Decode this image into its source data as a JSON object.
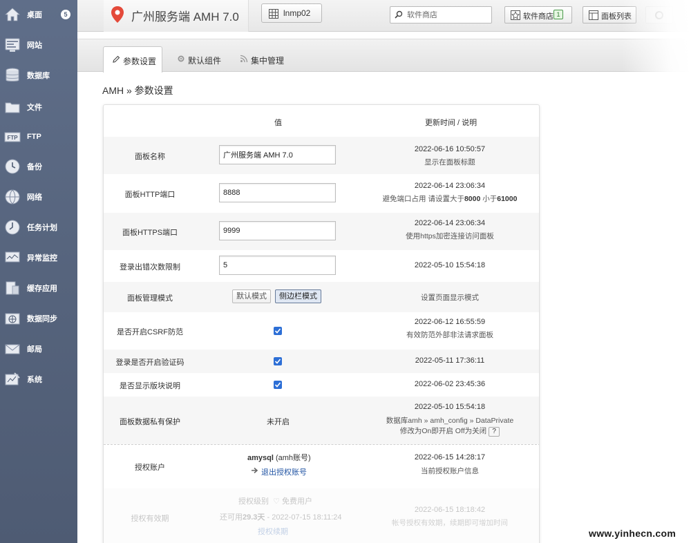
{
  "sidebar": {
    "items": [
      {
        "label": "桌面",
        "icon": "home-icon",
        "badge": "5"
      },
      {
        "label": "网站",
        "icon": "website-icon"
      },
      {
        "label": "数据库",
        "icon": "database-icon"
      },
      {
        "label": "文件",
        "icon": "folder-icon"
      },
      {
        "label": "FTP",
        "icon": "ftp-icon"
      },
      {
        "label": "备份",
        "icon": "backup-clock-icon"
      },
      {
        "label": "网络",
        "icon": "globe-icon"
      },
      {
        "label": "任务计划",
        "icon": "task-clock-icon"
      },
      {
        "label": "异常监控",
        "icon": "monitor-icon"
      },
      {
        "label": "缓存应用",
        "icon": "cache-icon"
      },
      {
        "label": "数据同步",
        "icon": "sync-icon"
      },
      {
        "label": "邮局",
        "icon": "mail-icon"
      },
      {
        "label": "系统",
        "icon": "system-icon"
      }
    ]
  },
  "header": {
    "brand_title": "广州服务端 AMH 7.0",
    "env_button": "lnmp02",
    "search_placeholder": "软件商店",
    "store_button": "软件商店",
    "store_count": "1",
    "panels_button": "面板列表"
  },
  "tabs": [
    {
      "label": "参数设置",
      "active": true
    },
    {
      "label": "默认组件",
      "active": false
    },
    {
      "label": "集中管理",
      "active": false
    }
  ],
  "breadcrumb": "AMH » 参数设置",
  "table": {
    "header_value": "值",
    "header_time": "更新时间 / 说明",
    "rows": {
      "panel_name": {
        "label": "面板名称",
        "value": "广州服务端 AMH 7.0",
        "time": "2022-06-16 10:50:57",
        "desc": "显示在面板标题"
      },
      "http_port": {
        "label": "面板HTTP端口",
        "value": "8888",
        "time": "2022-06-14 23:06:34",
        "desc_a": "避免端口占用 请设置大于",
        "desc_b": "8000",
        "desc_c": " 小于",
        "desc_d": "61000"
      },
      "https_port": {
        "label": "面板HTTPS端口",
        "value": "9999",
        "time": "2022-06-14 23:06:34",
        "desc": "使用https加密连接访问面板"
      },
      "login_limit": {
        "label": "登录出错次数限制",
        "value": "5",
        "time": "2022-05-10 15:54:18"
      },
      "panel_mode": {
        "label": "面板管理模式",
        "mode_default": "默认模式",
        "mode_sidebar": "侧边栏模式",
        "desc": "设置页面显示模式"
      },
      "csrf": {
        "label": "是否开启CSRF防范",
        "checked": true,
        "time": "2022-06-12 16:55:59",
        "desc": "有效防范外部非法请求面板"
      },
      "captcha": {
        "label": "登录是否开启验证码",
        "checked": true,
        "time": "2022-05-11 17:36:11"
      },
      "block_desc": {
        "label": "是否显示版块说明",
        "checked": true,
        "time": "2022-06-02 23:45:36"
      },
      "private": {
        "label": "面板数据私有保护",
        "value": "未开启",
        "time": "2022-05-10 15:54:18",
        "desc1": "数据库amh » amh_config » DataPrivate",
        "desc2": "修改为On即开启 Off为关闭",
        "help": "?"
      },
      "auth_account": {
        "label": "授权账户",
        "account": "amysql",
        "account_note": "(amh账号)",
        "logout": "退出授权账号",
        "time": "2022-06-15 14:28:17",
        "desc": "当前授权账户信息"
      },
      "auth_validity": {
        "label": "授权有效期",
        "level_label": "授权级别",
        "level_value": "免费用户",
        "remain_a": "还可用",
        "remain_b": "29.3天",
        "remain_c": " - 2022-07-15 18:11:24",
        "renew": "授权续期",
        "time": "2022-06-15 18:18:42",
        "desc": "帐号授权有效期，续期即可增加时间"
      }
    }
  },
  "watermark": "www.yinhecn.com",
  "colors": {
    "sidebar": "#56647d",
    "checkbox": "#2d6fd6",
    "link": "#2255a4"
  }
}
